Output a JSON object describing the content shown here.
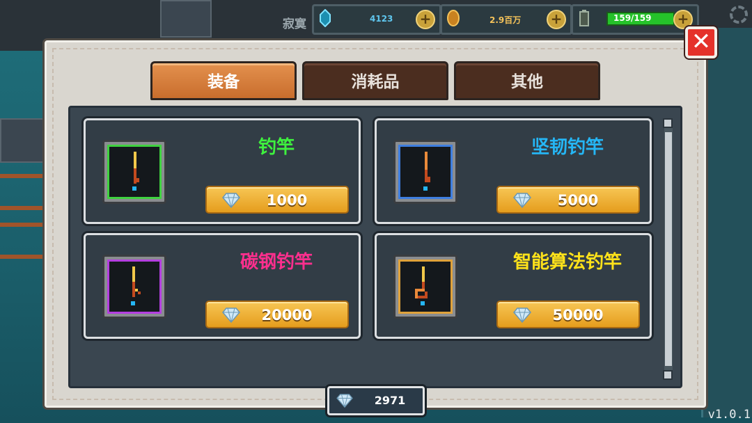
{
  "hud": {
    "player_name": "寂寞",
    "gems": "4123",
    "gold": "2.9百万",
    "energy": "159/159"
  },
  "tabs": [
    {
      "label": "装备",
      "active": true
    },
    {
      "label": "消耗品",
      "active": false
    },
    {
      "label": "其他",
      "active": false
    }
  ],
  "items": [
    {
      "name": "钓竿",
      "price": "1000",
      "name_color": "#3ef23e",
      "frame_color": "#3fd23f"
    },
    {
      "name": "坚韧钓竿",
      "price": "5000",
      "name_color": "#25b6f5",
      "frame_color": "#3e7ee0"
    },
    {
      "name": "碳钢钓竿",
      "price": "20000",
      "name_color": "#ff2f8e",
      "frame_color": "#b43ee0"
    },
    {
      "name": "智能算法钓竿",
      "price": "50000",
      "name_color": "#ffe21a",
      "frame_color": "#e0a23a"
    }
  ],
  "balance": "2971",
  "version": "v1.0.1",
  "icons": {
    "close": "close-icon",
    "gem": "diamond-icon",
    "plus": "plus-icon",
    "settings": "gear-icon"
  }
}
